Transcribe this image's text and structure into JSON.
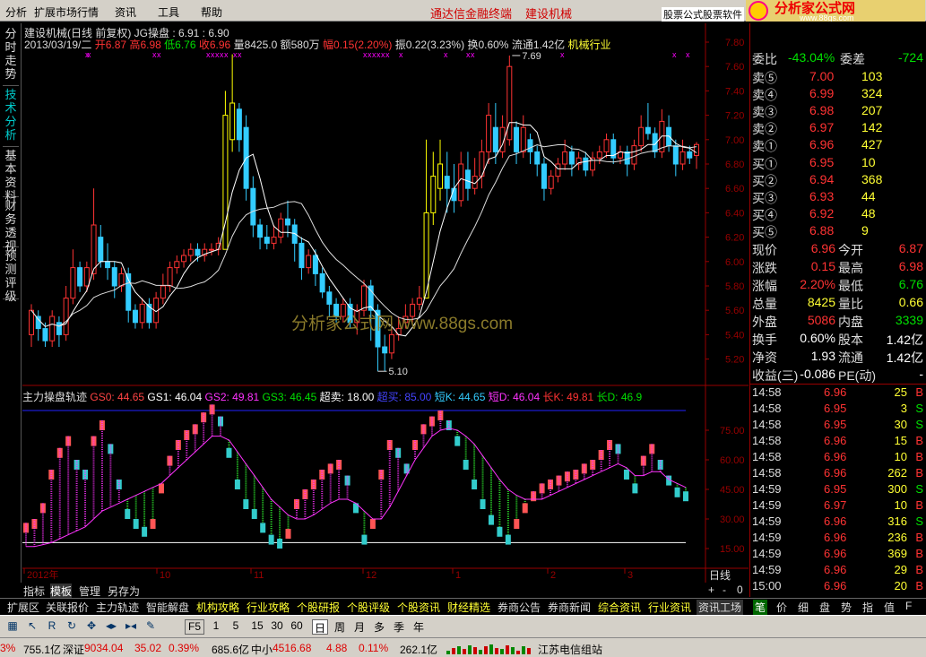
{
  "menu": {
    "items": [
      "分析",
      "扩展市场行情",
      "资讯",
      "工具",
      "帮助"
    ],
    "center_title": "通达信金融终端",
    "stock_title": "建设机械",
    "ad_text": "股票公式股票软件",
    "logo_text": "分析家公式网",
    "logo_url": "www.88gs.com"
  },
  "vtabs": [
    "分时走势",
    "技术分析",
    "基本资料",
    "财务透视",
    "预测评级"
  ],
  "header": {
    "line1": "建设机械(日线 前复权) JG操盘 : 6.91 : 6.90",
    "date": "2013/03/19/二",
    "open": "开6.87",
    "high": "高6.98",
    "low": "低6.76",
    "close": "收6.96",
    "vol": "量8425.0",
    "amt": "额580万",
    "chg": "幅0.15(2.20%)",
    "amp": "振0.22(3.23%)",
    "turn": "换0.60%",
    "float": "流通1.42亿",
    "industry": "机械行业"
  },
  "price_axis": [
    "7.80",
    "7.60",
    "7.40",
    "7.20",
    "7.00",
    "6.80",
    "6.60",
    "6.40",
    "6.20",
    "6.00",
    "5.80",
    "5.60",
    "5.40",
    "5.20"
  ],
  "price_marks": {
    "high_label": "7.69",
    "low_label": "5.10"
  },
  "watermark": "分析家公式网 www.88gs.com",
  "indicator": {
    "name": "主力操盘轨迹",
    "gs0": "GS0: 44.65",
    "gs1": "GS1: 46.04",
    "gs2": "GS2: 49.81",
    "gs3": "GS3: 46.45",
    "overbuy": "超卖: 18.00",
    "oversell": "超买: 85.00",
    "shortk": "短K: 44.65",
    "shortd": "短D: 46.04",
    "longk": "长K: 49.81",
    "longd": "长D: 46.9",
    "axis": [
      "75.00",
      "60.00",
      "45.00",
      "30.00",
      "15.00"
    ]
  },
  "time_axis": [
    "2012年",
    "10",
    "11",
    "12",
    "1",
    "2",
    "3"
  ],
  "period_label": "日线",
  "bottom_tabs": [
    "指标",
    "模板",
    "管理",
    "另存为"
  ],
  "zoom": [
    "+",
    "-",
    "0"
  ],
  "quote": {
    "weibi": {
      "l1": "委比",
      "v1": "-43.04%",
      "l2": "委差",
      "v2": "-724"
    },
    "sell": [
      {
        "l": "卖⑤",
        "p": "7.00",
        "v": "103"
      },
      {
        "l": "卖④",
        "p": "6.99",
        "v": "324"
      },
      {
        "l": "卖③",
        "p": "6.98",
        "v": "207"
      },
      {
        "l": "卖②",
        "p": "6.97",
        "v": "142"
      },
      {
        "l": "卖①",
        "p": "6.96",
        "v": "427"
      }
    ],
    "buy": [
      {
        "l": "买①",
        "p": "6.95",
        "v": "10"
      },
      {
        "l": "买②",
        "p": "6.94",
        "v": "368"
      },
      {
        "l": "买③",
        "p": "6.93",
        "v": "44"
      },
      {
        "l": "买④",
        "p": "6.92",
        "v": "48"
      },
      {
        "l": "买⑤",
        "p": "6.88",
        "v": "9"
      }
    ],
    "stats": [
      {
        "l1": "现价",
        "v1": "6.96",
        "c1": "red",
        "l2": "今开",
        "v2": "6.87",
        "c2": "red"
      },
      {
        "l1": "涨跌",
        "v1": "0.15",
        "c1": "red",
        "l2": "最高",
        "v2": "6.98",
        "c2": "red"
      },
      {
        "l1": "涨幅",
        "v1": "2.20%",
        "c1": "red",
        "l2": "最低",
        "v2": "6.76",
        "c2": "grn"
      },
      {
        "l1": "总量",
        "v1": "8425",
        "c1": "yel",
        "l2": "量比",
        "v2": "0.66",
        "c2": "yel"
      },
      {
        "l1": "外盘",
        "v1": "5086",
        "c1": "red",
        "l2": "内盘",
        "v2": "3339",
        "c2": "grn"
      },
      {
        "l1": "换手",
        "v1": "0.60%",
        "c1": "wht",
        "l2": "股本",
        "v2": "1.42亿",
        "c2": "wht"
      },
      {
        "l1": "净资",
        "v1": "1.93",
        "c1": "wht",
        "l2": "流通",
        "v2": "1.42亿",
        "c2": "wht"
      },
      {
        "l1": "收益(三)",
        "v1": "-0.086",
        "c1": "wht",
        "l2": "PE(动)",
        "v2": "-",
        "c2": "wht"
      }
    ]
  },
  "ticks": [
    {
      "t": "14:58",
      "p": "6.96",
      "v": "25",
      "s": "B"
    },
    {
      "t": "14:58",
      "p": "6.95",
      "v": "3",
      "s": "S"
    },
    {
      "t": "14:58",
      "p": "6.95",
      "v": "30",
      "s": "S"
    },
    {
      "t": "14:58",
      "p": "6.96",
      "v": "15",
      "s": "B"
    },
    {
      "t": "14:58",
      "p": "6.96",
      "v": "10",
      "s": "B"
    },
    {
      "t": "14:58",
      "p": "6.96",
      "v": "262",
      "s": "B"
    },
    {
      "t": "14:59",
      "p": "6.95",
      "v": "300",
      "s": "S"
    },
    {
      "t": "14:59",
      "p": "6.97",
      "v": "10",
      "s": "B"
    },
    {
      "t": "14:59",
      "p": "6.96",
      "v": "316",
      "s": "S"
    },
    {
      "t": "14:59",
      "p": "6.96",
      "v": "236",
      "s": "B"
    },
    {
      "t": "14:59",
      "p": "6.96",
      "v": "369",
      "s": "B"
    },
    {
      "t": "14:59",
      "p": "6.96",
      "v": "29",
      "s": "B"
    },
    {
      "t": "15:00",
      "p": "6.96",
      "v": "20",
      "s": "B"
    }
  ],
  "links": [
    {
      "t": "扩展区",
      "c": "#dddddd"
    },
    {
      "t": "关联报价",
      "c": "#dddddd"
    },
    {
      "t": "主力轨迹",
      "c": "#dddddd"
    },
    {
      "t": "智能解盘",
      "c": "#dddddd"
    },
    {
      "t": "机构攻略",
      "c": "#ffff33"
    },
    {
      "t": "行业攻略",
      "c": "#ffff33"
    },
    {
      "t": "个股研报",
      "c": "#ffff33"
    },
    {
      "t": "个股评级",
      "c": "#ffff33"
    },
    {
      "t": "个股资讯",
      "c": "#ffff33"
    },
    {
      "t": "财经精选",
      "c": "#ffff33"
    },
    {
      "t": "券商公告",
      "c": "#dddddd"
    },
    {
      "t": "券商新闻",
      "c": "#dddddd"
    },
    {
      "t": "综合资讯",
      "c": "#ffff33"
    },
    {
      "t": "行业资讯",
      "c": "#ffff33"
    },
    {
      "t": "资讯工场",
      "c": "#dddddd"
    }
  ],
  "side_tabs": [
    "笔",
    "价",
    "细",
    "盘",
    "势",
    "指",
    "值",
    "F"
  ],
  "toolbar": {
    "periods": [
      "F5",
      "1",
      "5",
      "15",
      "30",
      "60",
      "日",
      "周",
      "月",
      "多",
      "季",
      "年"
    ],
    "active": "日"
  },
  "status": {
    "s1": "3%",
    "s2": "755.1亿",
    "s3": "深证",
    "s4": "9034.04",
    "s5": "35.02",
    "s6": "0.39%",
    "s7": "685.6亿",
    "s8": "中小",
    "s9": "4516.68",
    "s10": "4.88",
    "s11": "0.11%",
    "s12": "262.1亿",
    "s13": "江苏电信组站"
  },
  "colors": {
    "up": "#ff3333",
    "down": "#33ccff",
    "yellow": "#ffff00"
  }
}
